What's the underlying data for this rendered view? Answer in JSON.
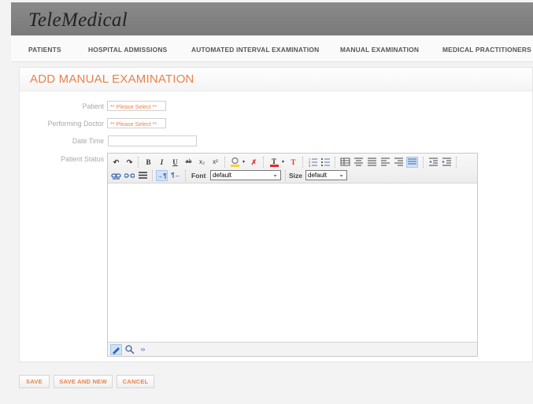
{
  "app": {
    "title": "TeleMedical"
  },
  "nav": {
    "items": [
      {
        "label": "PATIENTS"
      },
      {
        "label": "HOSPITAL ADMISSIONS"
      },
      {
        "label": "AUTOMATED INTERVAL EXAMINATION"
      },
      {
        "label": "MANUAL EXAMINATION"
      },
      {
        "label": "MEDICAL PRACTITIONERS"
      }
    ]
  },
  "form": {
    "title": "ADD MANUAL EXAMINATION",
    "patient": {
      "label": "Patient",
      "value": "** Please Select **"
    },
    "doctor": {
      "label": "Performing Doctor",
      "value": "** Please Select **"
    },
    "datetime": {
      "label": "Date Time",
      "value": ""
    },
    "status": {
      "label": "Patient Status"
    }
  },
  "editor": {
    "font_label": "Font",
    "font_value": "default",
    "size_label": "Size",
    "size_value": "default",
    "buttons": {
      "undo": "↶",
      "redo": "↷",
      "bold": "B",
      "italic": "I",
      "underline": "U",
      "strike": "ab",
      "sub": "x₂",
      "sup": "x²"
    }
  },
  "actions": {
    "save": "SAVE",
    "save_new": "SAVE AND NEW",
    "cancel": "CANCEL"
  },
  "colors": {
    "accent": "#e8834b",
    "header": "#808080"
  }
}
